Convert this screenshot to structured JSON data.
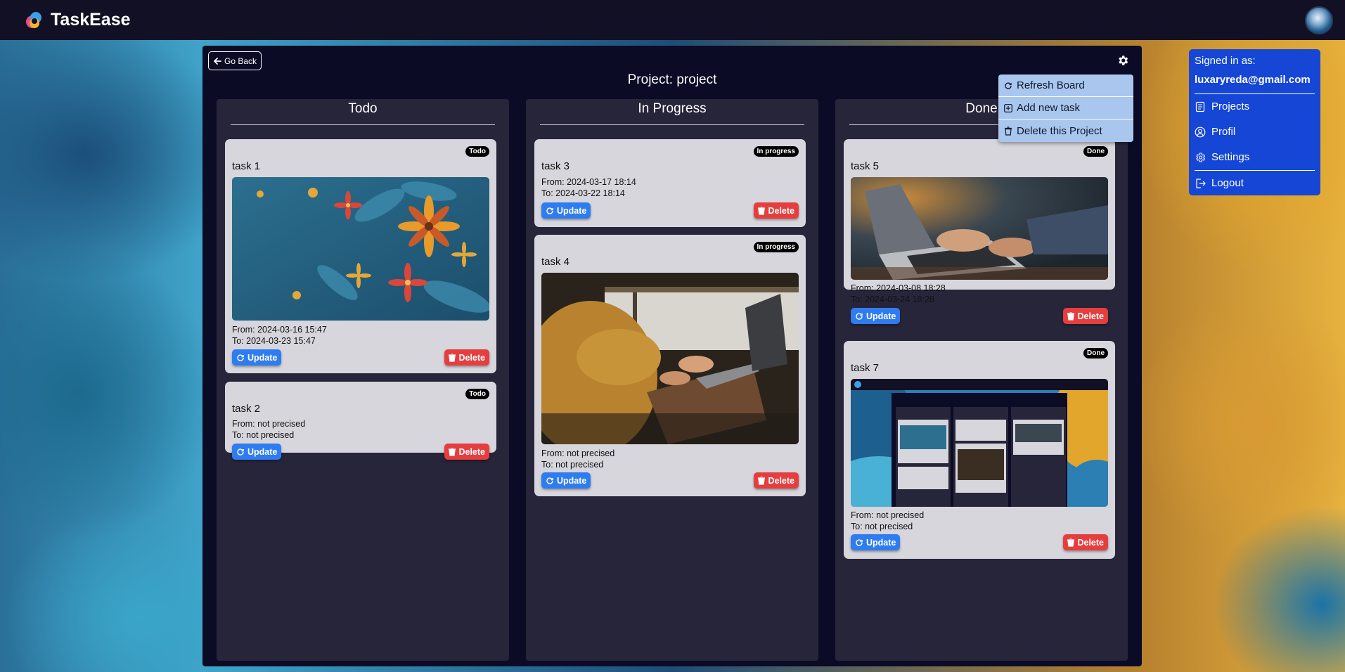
{
  "app": {
    "title": "TaskEase"
  },
  "board": {
    "back_label": "Go Back",
    "project_title": "Project: project"
  },
  "columns": [
    {
      "title": "Todo",
      "cards": [
        {
          "name": "task 1",
          "badge": "Todo",
          "has_image": true,
          "image": "paper-flowers",
          "from": "From: 2024-03-16 15:47",
          "to": "To: 2024-03-23 15:47"
        },
        {
          "name": "task 2",
          "badge": "Todo",
          "has_image": false,
          "from": "From: not precised",
          "to": "To: not precised"
        }
      ]
    },
    {
      "title": "In Progress",
      "cards": [
        {
          "name": "task 3",
          "badge": "In progress",
          "has_image": false,
          "from": "From: 2024-03-17 18:14",
          "to": "To: 2024-03-22 18:14"
        },
        {
          "name": "task 4",
          "badge": "In progress",
          "has_image": true,
          "image": "person-typing-laptop",
          "from": "From: not precised",
          "to": "To: not precised"
        }
      ]
    },
    {
      "title": "Done",
      "cards": [
        {
          "name": "task 5",
          "badge": "Done",
          "has_image": true,
          "image": "hands-on-laptop",
          "from": "From: 2024-03-08 18:28",
          "to": "To: 2024-03-24 18:28"
        },
        {
          "name": "task 7",
          "badge": "Done",
          "has_image": true,
          "image": "taskease-screenshot",
          "from": "From: not precised",
          "to": "To: not precised"
        }
      ]
    }
  ],
  "buttons": {
    "update": "Update",
    "delete": "Delete"
  },
  "settings_menu": {
    "items": [
      "Refresh Board",
      "Add new task",
      "Delete this Project"
    ]
  },
  "user_menu": {
    "signed_in_label": "Signed in as:",
    "email": "luxaryreda@gmail.com",
    "items": [
      "Projects",
      "Profil",
      "Settings",
      "Logout"
    ]
  },
  "colors": {
    "update": "#2f7cf0",
    "delete": "#e53e3e",
    "user_panel": "#1546d6",
    "menu": "#a9c6ef"
  }
}
